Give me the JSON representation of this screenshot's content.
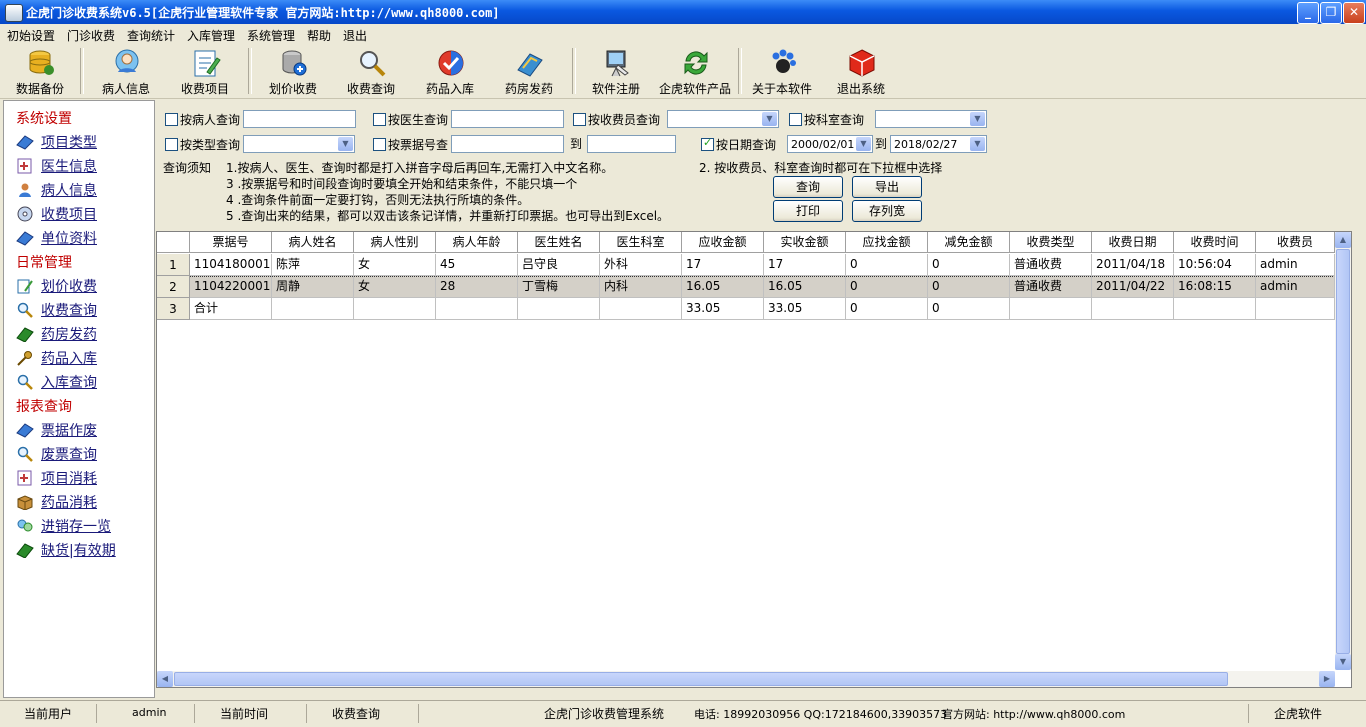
{
  "window": {
    "title": "企虎门诊收费系统v6.5[企虎行业管理软件专家 官方网站:http://www.qh8000.com]"
  },
  "menu": [
    "初始设置",
    "门诊收费",
    "查询统计",
    "入库管理",
    "系统管理",
    "帮助",
    "退出"
  ],
  "toolbar": [
    {
      "label": "数据备份",
      "icon": "database-icon"
    },
    {
      "label": "病人信息",
      "icon": "patient-icon"
    },
    {
      "label": "收费项目",
      "icon": "charge-item-icon"
    },
    {
      "label": "划价收费",
      "icon": "pricing-icon"
    },
    {
      "label": "收费查询",
      "icon": "magnifier-icon"
    },
    {
      "label": "药品入库",
      "icon": "medicine-in-icon"
    },
    {
      "label": "药房发药",
      "icon": "dispense-icon"
    },
    {
      "label": "软件注册",
      "icon": "register-icon"
    },
    {
      "label": "企虎软件产品",
      "icon": "refresh-icon"
    },
    {
      "label": "关于本软件",
      "icon": "about-icon"
    },
    {
      "label": "退出系统",
      "icon": "exit-cube-icon"
    }
  ],
  "sidebar": {
    "sections": [
      {
        "title": "系统设置",
        "items": [
          "项目类型",
          "医生信息",
          "病人信息",
          "收费项目",
          "单位资料"
        ]
      },
      {
        "title": "日常管理",
        "items": [
          "划价收费",
          "收费查询",
          "药房发药",
          "药品入库",
          "入库查询"
        ]
      },
      {
        "title": "报表查询",
        "items": [
          "票据作废",
          "废票查询",
          "项目消耗",
          "药品消耗",
          "进销存一览",
          "缺货|有效期"
        ]
      }
    ]
  },
  "query": {
    "by_patient": "按病人查询",
    "by_doctor": "按医生查询",
    "by_cashier": "按收费员查询",
    "by_dept": "按科室查询",
    "by_type": "按类型查询",
    "by_receipt": "按票据号查",
    "to_label": "到",
    "by_date": "按日期查询",
    "date_checked": true,
    "date_from": "2000/02/01",
    "date_to": "2018/02/27",
    "notes_title": "查询须知",
    "note1": "1.按病人、医生、查询时都是打入拼音字母后再回车,无需打入中文名称。",
    "note2": "2. 按收费员、科室查询时都可在下拉框中选择",
    "note3": "3 .按票据号和时间段查询时要填全开始和结束条件，不能只填一个",
    "note4": "4 .查询条件前面一定要打钩，否则无法执行所填的条件。",
    "note5": "5 .查询出来的结果，都可以双击该条记详情，并重新打印票据。也可导出到Excel。",
    "btn_query": "查询",
    "btn_export": "导出",
    "btn_print": "打印",
    "btn_savecol": "存列宽"
  },
  "table": {
    "columns": [
      "票据号",
      "病人姓名",
      "病人性别",
      "病人年龄",
      "医生姓名",
      "医生科室",
      "应收金额",
      "实收金额",
      "应找金额",
      "减免金额",
      "收费类型",
      "收费日期",
      "收费时间",
      "收费员"
    ],
    "rows": [
      {
        "n": "1",
        "cells": [
          "1104180001",
          "陈萍",
          "女",
          "45",
          "吕守良",
          "外科",
          "17",
          "17",
          "0",
          "0",
          "普通收费",
          "2011/04/18",
          "10:56:04",
          "admin"
        ]
      },
      {
        "n": "2",
        "cells": [
          "1104220001",
          "周静",
          "女",
          "28",
          "丁雪梅",
          "内科",
          "16.05",
          "16.05",
          "0",
          "0",
          "普通收费",
          "2011/04/22",
          "16:08:15",
          "admin"
        ]
      },
      {
        "n": "3",
        "cells": [
          "合计",
          "",
          "",
          "",
          "",
          "",
          "33.05",
          "33.05",
          "0",
          "0",
          "",
          "",
          "",
          ""
        ]
      }
    ],
    "selected_row": 2
  },
  "status": {
    "user_label": "当前用户",
    "user": "admin",
    "time_label": "当前时间",
    "module": "收费查询",
    "system": "企虎门诊收费管理系统",
    "contact": "电话: 18992030956 QQ:172184600,33903573",
    "website": "官方网站: http://www.qh8000.com",
    "brand": "企虎软件"
  }
}
